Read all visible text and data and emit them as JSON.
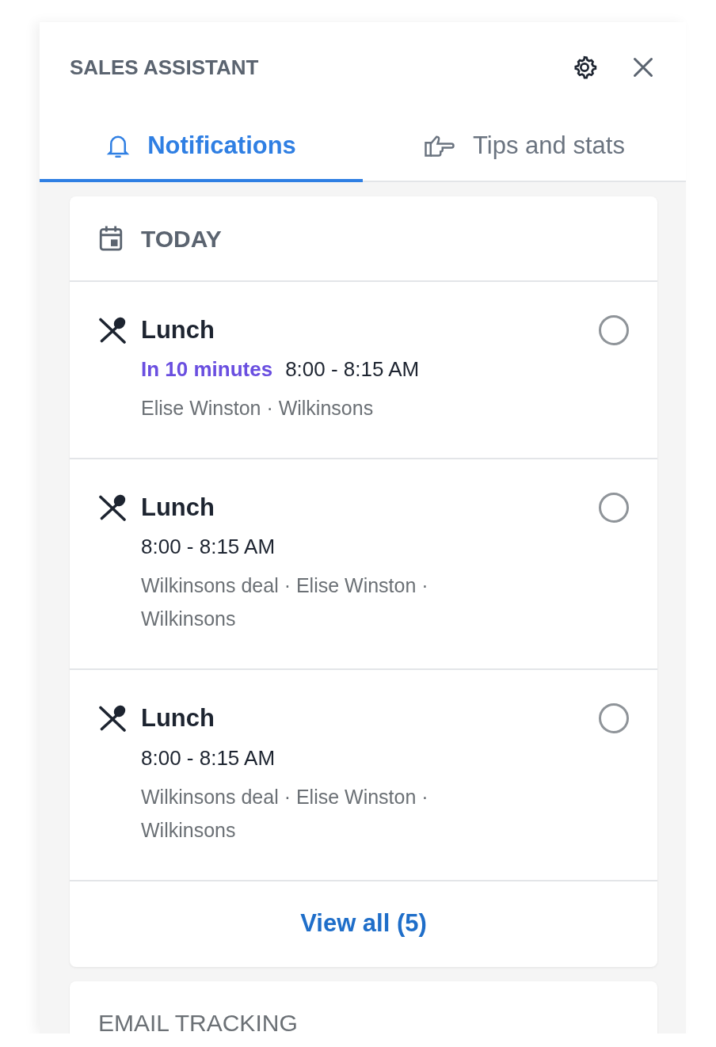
{
  "panel": {
    "title": "SALES ASSISTANT"
  },
  "tabs": [
    {
      "label": "Notifications",
      "selected": true
    },
    {
      "label": "Tips and stats",
      "selected": false
    }
  ],
  "today": {
    "heading": "TODAY",
    "events": [
      {
        "title": "Lunch",
        "due": "In 10 minutes",
        "time": "8:00 - 8:15 AM",
        "details": "Elise Winston · Wilkinsons",
        "checked": false
      },
      {
        "title": "Lunch",
        "time": "8:00 - 8:15 AM",
        "details": "Wilkinsons deal · Elise Winston · Wilkinsons",
        "checked": false
      },
      {
        "title": "Lunch",
        "time": "8:00 - 8:15 AM",
        "details": "Wilkinsons deal · Elise Winston · Wilkinsons",
        "checked": false
      }
    ],
    "view_all": "View all (5)"
  },
  "email_tracking": {
    "heading": "EMAIL TRACKING"
  }
}
